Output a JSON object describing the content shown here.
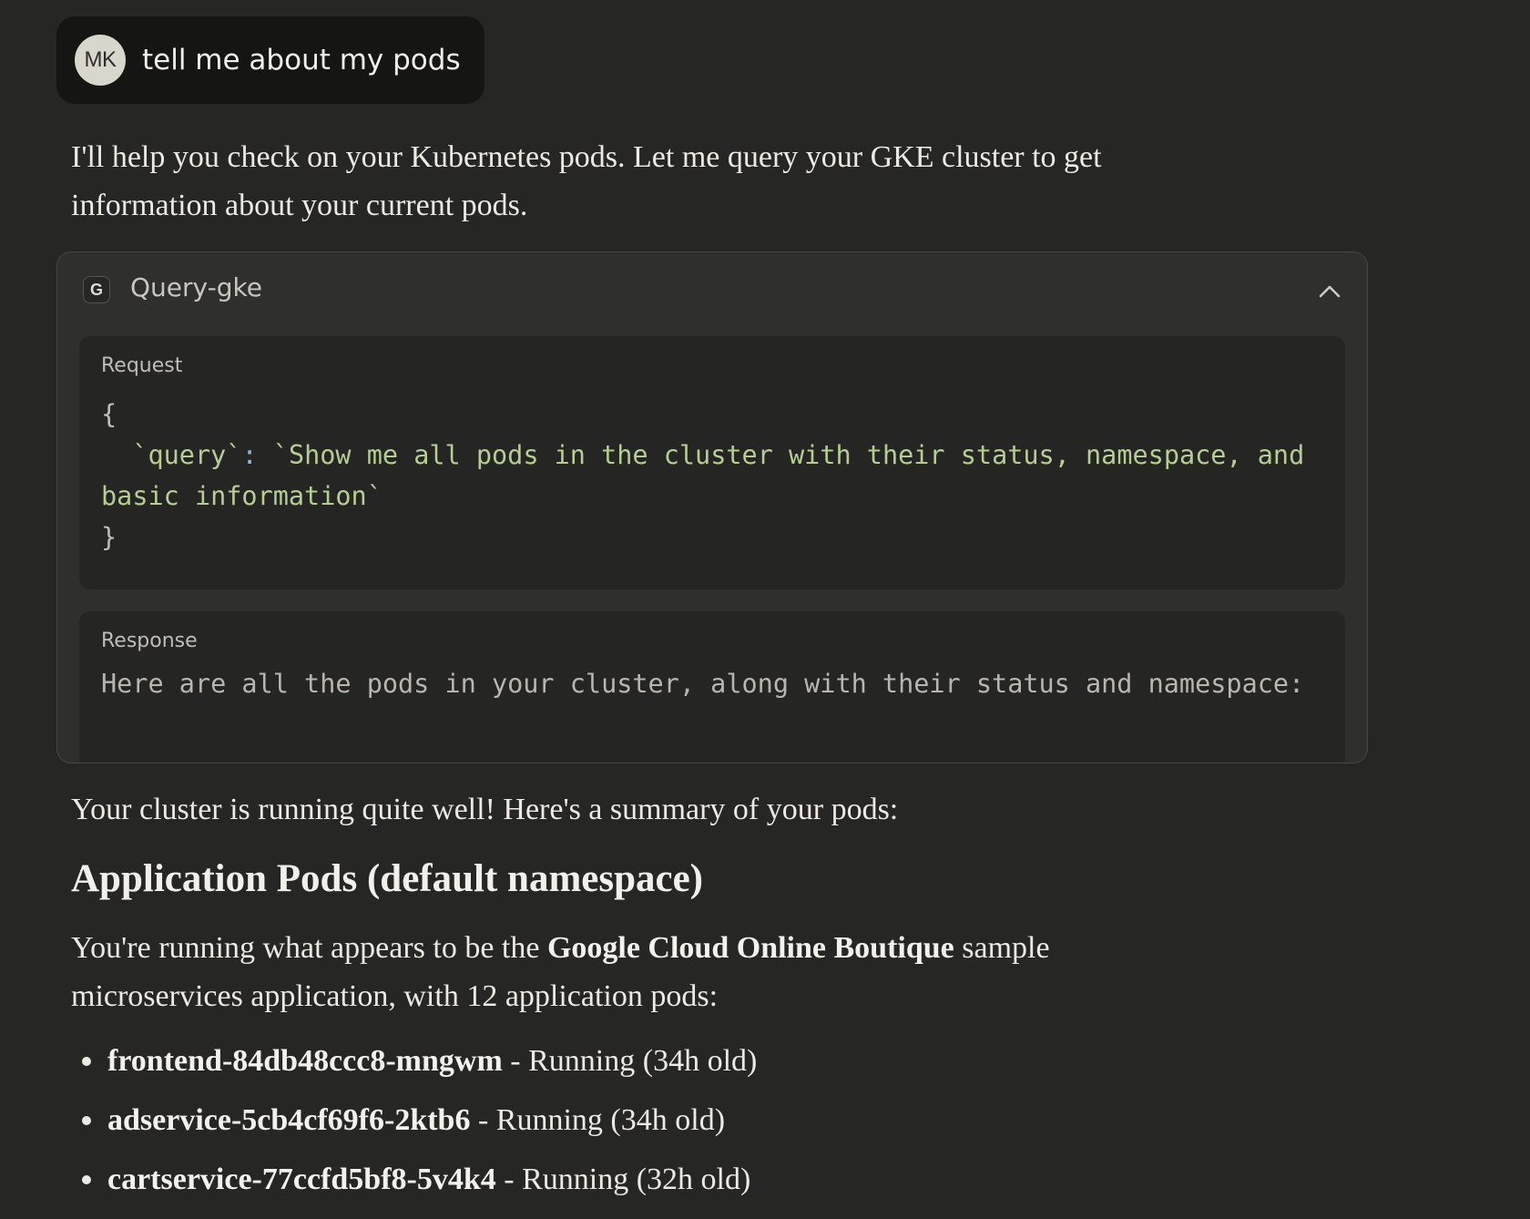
{
  "user_message": {
    "avatar_initials": "MK",
    "text": "tell me about my pods"
  },
  "intro": {
    "line1": "I'll help you check on your Kubernetes pods. Let me query your GKE cluster to get",
    "line2": "information about your current pods."
  },
  "tool_call": {
    "icon_letter": "G",
    "name": "Query-gke",
    "expanded": true,
    "request_label": "Request",
    "request_open_brace": "{",
    "request_key": "`query`",
    "request_colon": ":",
    "request_value": "`Show me all pods in the cluster with their status, namespace, and basic information`",
    "request_close_brace": "}",
    "response_label": "Response",
    "response_text": "Here are all the pods in your cluster, along with their status and namespace:"
  },
  "summary_line": "Your cluster is running quite well! Here's a summary of your pods:",
  "section_heading": "Application Pods (default namespace)",
  "section_para": {
    "before": "You're running what appears to be the ",
    "bold": "Google Cloud Online Boutique",
    "after_line1": " sample",
    "line2": "microservices application, with 12 application pods:"
  },
  "pods": [
    {
      "name": "frontend-84db48ccc8-mngwm",
      "status": " - Running (34h old)"
    },
    {
      "name": "adservice-5cb4cf69f6-2ktb6",
      "status": " - Running (34h old)"
    },
    {
      "name": "cartservice-77ccfd5bf8-5v4k4",
      "status": " - Running (32h old)"
    }
  ],
  "colors": {
    "background": "#262624",
    "user_bubble": "#151514",
    "tool_card": "#2F2F2D",
    "code_box": "#252523",
    "code_string": "#B5CE92"
  },
  "icons": [
    "avatar",
    "tool-g-icon",
    "chevron-up-icon"
  ]
}
